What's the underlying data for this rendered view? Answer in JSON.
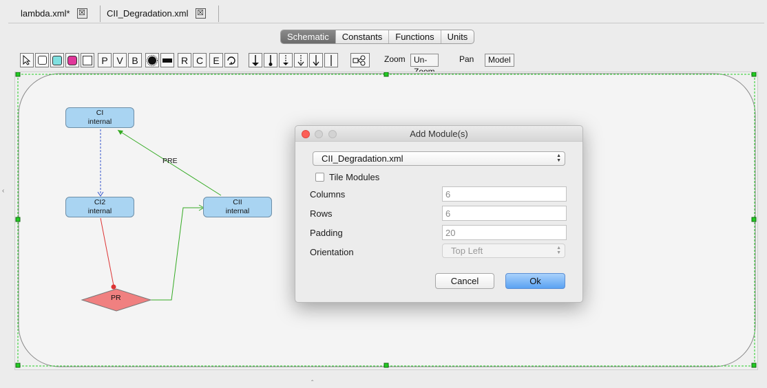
{
  "document_tabs": [
    {
      "label": "lambda.xml*",
      "close": "☒"
    },
    {
      "label": "CII_Degradation.xml",
      "close": "☒"
    }
  ],
  "view_tabs": [
    {
      "label": "Schematic",
      "active": true
    },
    {
      "label": "Constants",
      "active": false
    },
    {
      "label": "Functions",
      "active": false
    },
    {
      "label": "Units",
      "active": false
    }
  ],
  "toolbar": {
    "letter_tools": [
      "P",
      "V",
      "B",
      "R",
      "C",
      "E"
    ],
    "zoom_label": "Zoom",
    "unzoom_label": "Un-Zoom",
    "pan_label": "Pan",
    "model_label": "Model"
  },
  "schematic": {
    "nodes": [
      {
        "line1": "CI",
        "line2": "internal"
      },
      {
        "line1": "CI2",
        "line2": "internal"
      },
      {
        "line1": "CII",
        "line2": "internal"
      }
    ],
    "promoter": "PR",
    "edge_label": "PRE",
    "colors": {
      "species_fill": "#a9d4f2",
      "promoter_fill": "#f08080",
      "activation_edge": "#33aa22",
      "repression_edge": "#dd3333",
      "complex_edge": "#3355cc",
      "selection_handle": "#22cc22"
    }
  },
  "dialog": {
    "title": "Add Module(s)",
    "module_selected": "CII_Degradation.xml",
    "tile_modules_label": "Tile Modules",
    "tile_modules_checked": false,
    "fields": [
      {
        "label": "Columns",
        "value": "6"
      },
      {
        "label": "Rows",
        "value": "6"
      },
      {
        "label": "Padding",
        "value": "20"
      }
    ],
    "orientation_label": "Orientation",
    "orientation_value": "Top Left",
    "cancel_label": "Cancel",
    "ok_label": "Ok"
  }
}
